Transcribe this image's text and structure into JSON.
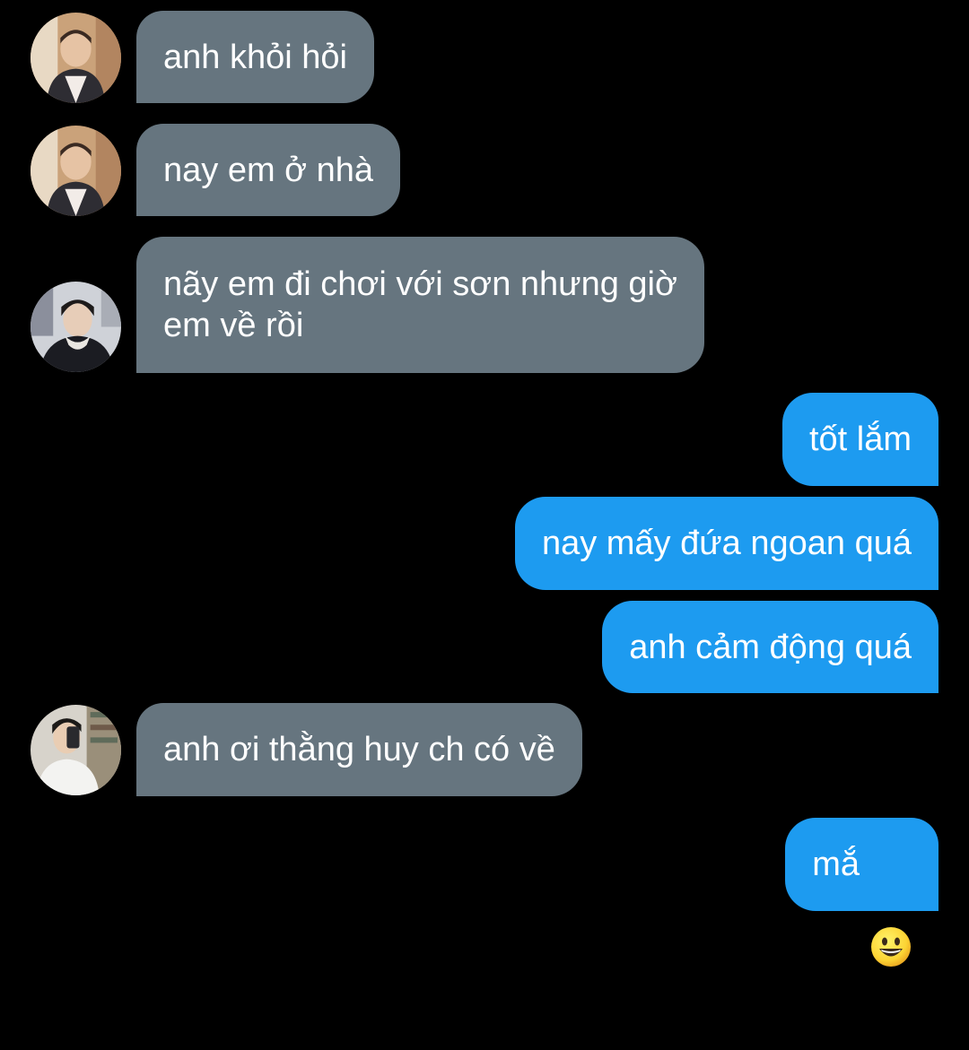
{
  "conversation": {
    "messages": [
      {
        "direction": "incoming",
        "text": "anh khỏi hỏi",
        "avatar": "avatar-1"
      },
      {
        "direction": "incoming",
        "text": "nay em ở nhà",
        "avatar": "avatar-1"
      },
      {
        "direction": "incoming",
        "text": "nãy em đi chơi với sơn nhưng giờ\nem về rồi",
        "avatar": "avatar-2"
      },
      {
        "direction": "outgoing",
        "text": "tốt lắm"
      },
      {
        "direction": "outgoing",
        "text": "nay mấy đứa ngoan quá"
      },
      {
        "direction": "outgoing",
        "text": "anh cảm động quá"
      },
      {
        "direction": "incoming",
        "text": "anh ơi thằng huy ch có về",
        "avatar": "avatar-3"
      },
      {
        "direction": "outgoing",
        "text": "mắ",
        "emoji": "grinning-face-emoji"
      }
    ]
  },
  "colors": {
    "background": "#000000",
    "incoming_bubble": "#66757f",
    "outgoing_bubble": "#1d9bf0",
    "text": "#ffffff"
  }
}
